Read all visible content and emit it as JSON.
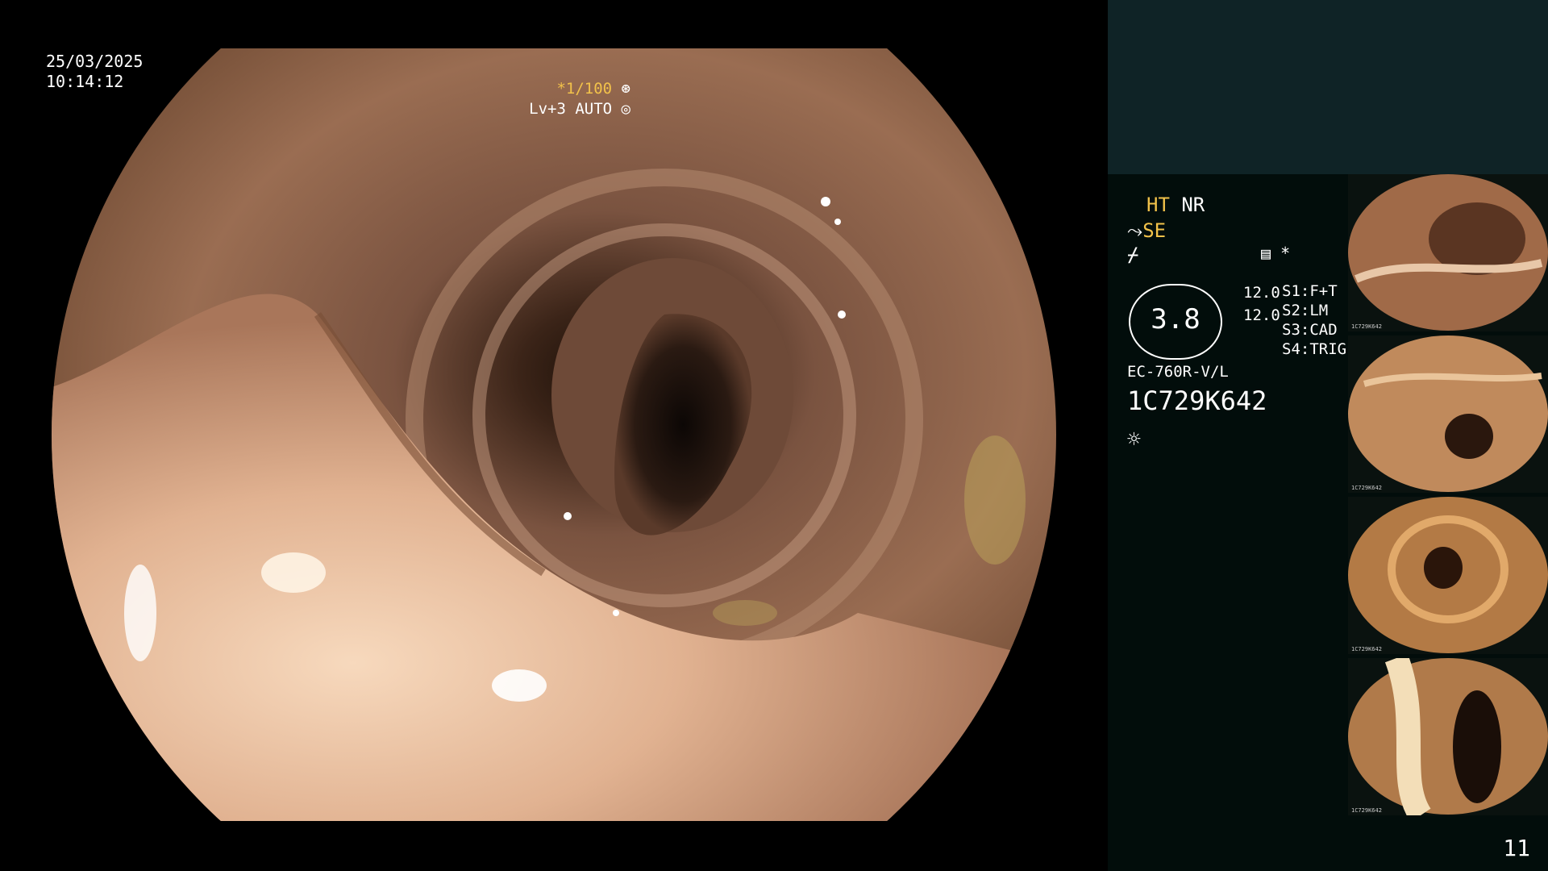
{
  "osd": {
    "date": "25/03/2025",
    "time": "10:14:12",
    "shutter": "*1/100",
    "iris": "Lv+3 AUTO"
  },
  "panel": {
    "ht": "HT",
    "nr": "NR",
    "se": "SE",
    "gauge_value": "3.8",
    "value_a": "12.0",
    "value_b": "12.0",
    "s1": "S1:F+T",
    "s2": "S2:LM",
    "s3": "S3:CAD",
    "s4": "S4:TRIG",
    "scope_model": "EC-760R-V/L",
    "serial": "1C729K642",
    "asterisk": "*",
    "icons": [
      "scope-symbol-icon",
      "scissor-icon",
      "menu-icon",
      "light-icon"
    ]
  },
  "thumbnails": [
    {
      "caption": "1C729K642"
    },
    {
      "caption": "1C729K642"
    },
    {
      "caption": "1C729K642"
    },
    {
      "caption": "1C729K642"
    }
  ],
  "page_number": "11",
  "colors": {
    "panel_bg": "#020d0b",
    "panel_top": "#0f2326",
    "accent": "#f2c24a"
  }
}
